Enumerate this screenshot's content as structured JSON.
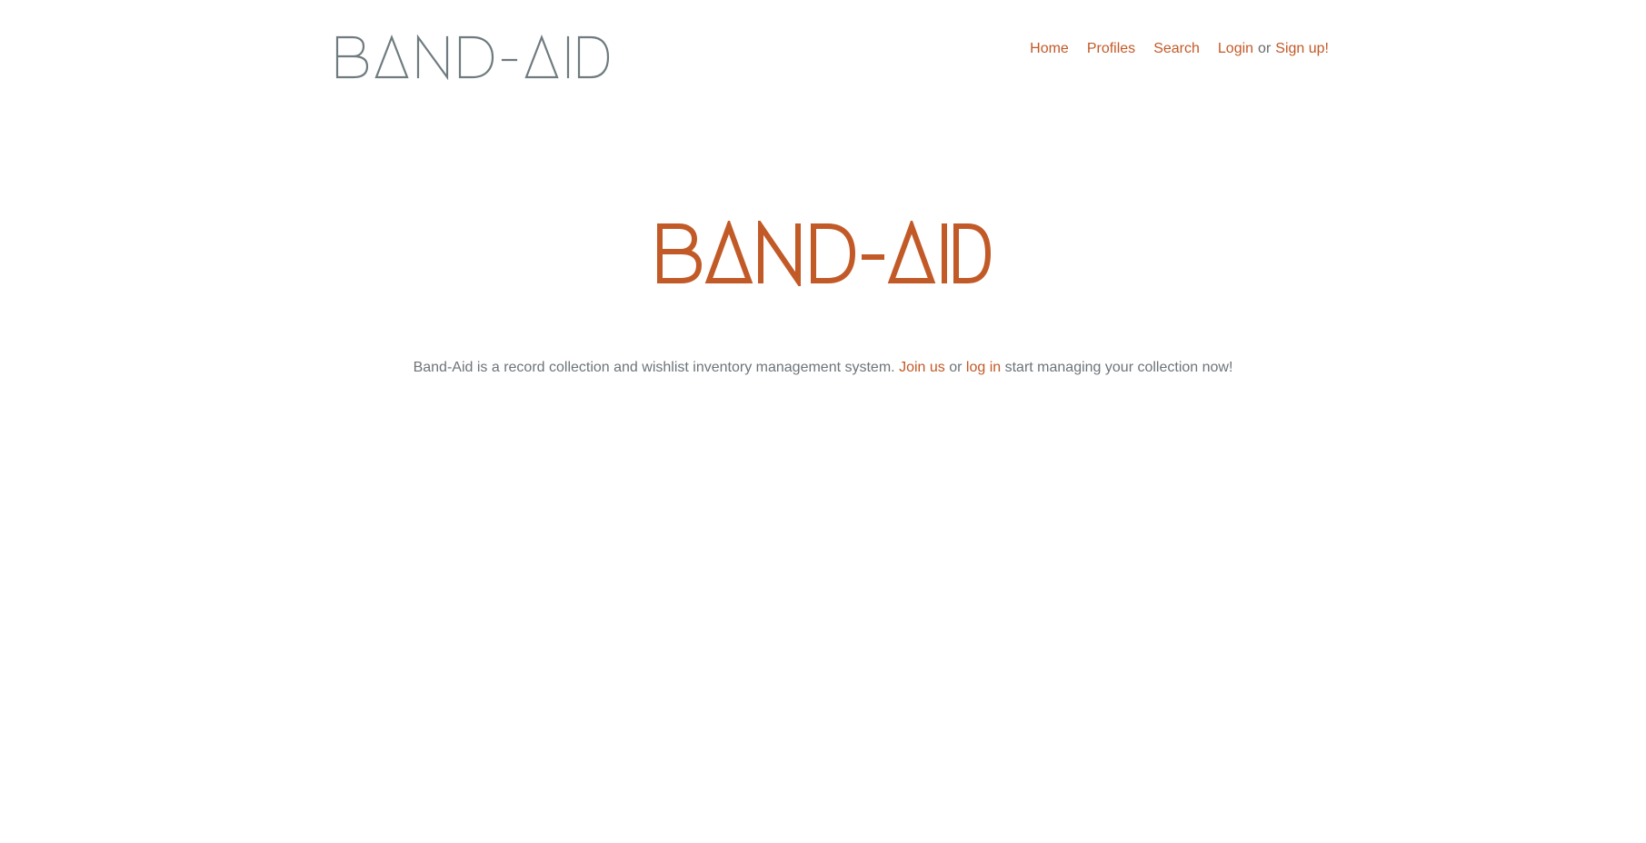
{
  "brand": {
    "header_logo_text": "BAND-AID",
    "hero_logo_text": "BAND-AID",
    "header_logo_color": "#6f7b7f",
    "hero_logo_color": "#c25a28"
  },
  "nav": {
    "home": "Home",
    "profiles": "Profiles",
    "search": "Search",
    "login": "Login",
    "or_text": "or",
    "signup": "Sign up!"
  },
  "hero": {
    "description": "Band-Aid is a record collection and wishlist inventory management system.",
    "join_link": "Join us",
    "or_text": "or",
    "login_link": "log in",
    "tail_text": "start managing your collection now!"
  },
  "colors": {
    "accent": "#c25a28",
    "muted_text": "#6e7479",
    "background": "#ffffff"
  }
}
